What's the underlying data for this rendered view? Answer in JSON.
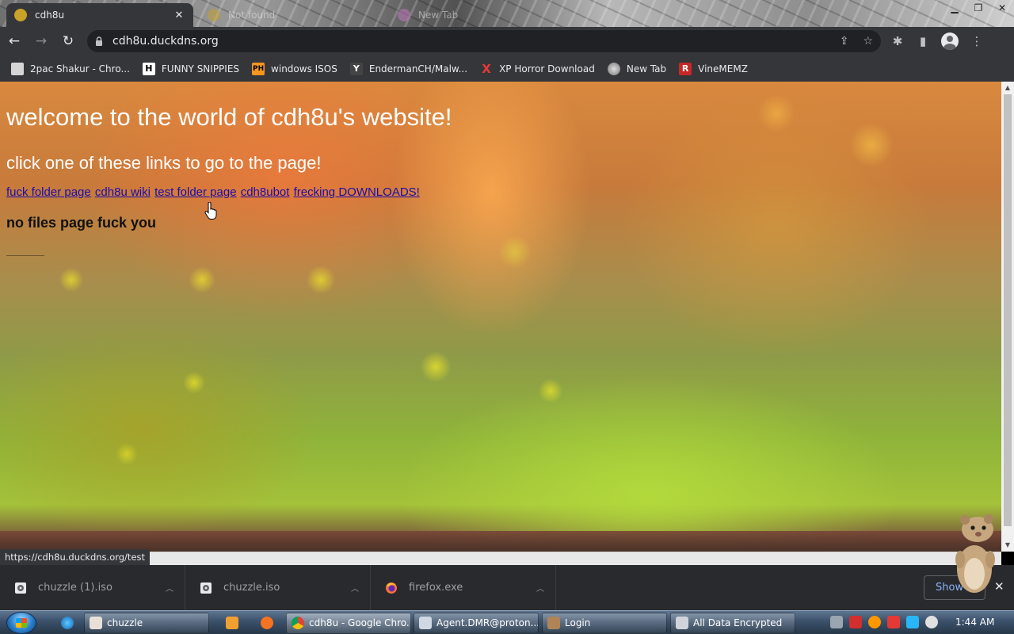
{
  "browser": {
    "tabs": [
      {
        "title": "cdh8u",
        "active": true
      },
      {
        "title": "Not found",
        "active": false
      },
      {
        "title": "New Tab",
        "active": false
      }
    ],
    "window_controls": {
      "minimize": "▁",
      "restore": "❐",
      "close": "✕"
    },
    "address": "cdh8u.duckdns.org",
    "bookmarks": [
      {
        "label": "2pac Shakur - Chro...",
        "icon": "camera-icon"
      },
      {
        "label": "FUNNY SNIPPIES",
        "icon": "H"
      },
      {
        "label": "windows ISOS",
        "icon": "PH"
      },
      {
        "label": "EndermanCH/Malw...",
        "icon": "Y"
      },
      {
        "label": "XP Horror Download",
        "icon": "X"
      },
      {
        "label": "New Tab",
        "icon": "globe-icon"
      },
      {
        "label": "VineMEMZ",
        "icon": "R"
      }
    ],
    "status_url": "https://cdh8u.duckdns.org/test",
    "colors": {
      "chrome_dark": "#35363a",
      "omnibox": "#202124",
      "link": "#1a0dab",
      "download_link": "#8ab4f8"
    }
  },
  "page": {
    "heading": "welcome to the world of cdh8u's website!",
    "subheading": "click one of these links to go to the page!",
    "links": [
      "fuck folder page",
      "cdh8u wiki",
      "test folder page",
      "cdh8ubot",
      "frecking DOWNLOADS!"
    ],
    "notice": "no files page fuck you"
  },
  "downloads": {
    "items": [
      {
        "name": "chuzzle (1).iso",
        "icon": "disc-image-icon"
      },
      {
        "name": "chuzzle.iso",
        "icon": "disc-image-icon"
      },
      {
        "name": "firefox.exe",
        "icon": "firefox-icon"
      }
    ],
    "show_all": "Show all"
  },
  "taskbar": {
    "buttons": [
      {
        "label": "chuzzle"
      },
      {
        "label": "cdh8u - Google Chro..."
      },
      {
        "label": "Agent.DMR@proton..."
      },
      {
        "label": "Login"
      },
      {
        "label": "All Data Encrypted"
      }
    ],
    "clock": "1:44 AM"
  }
}
